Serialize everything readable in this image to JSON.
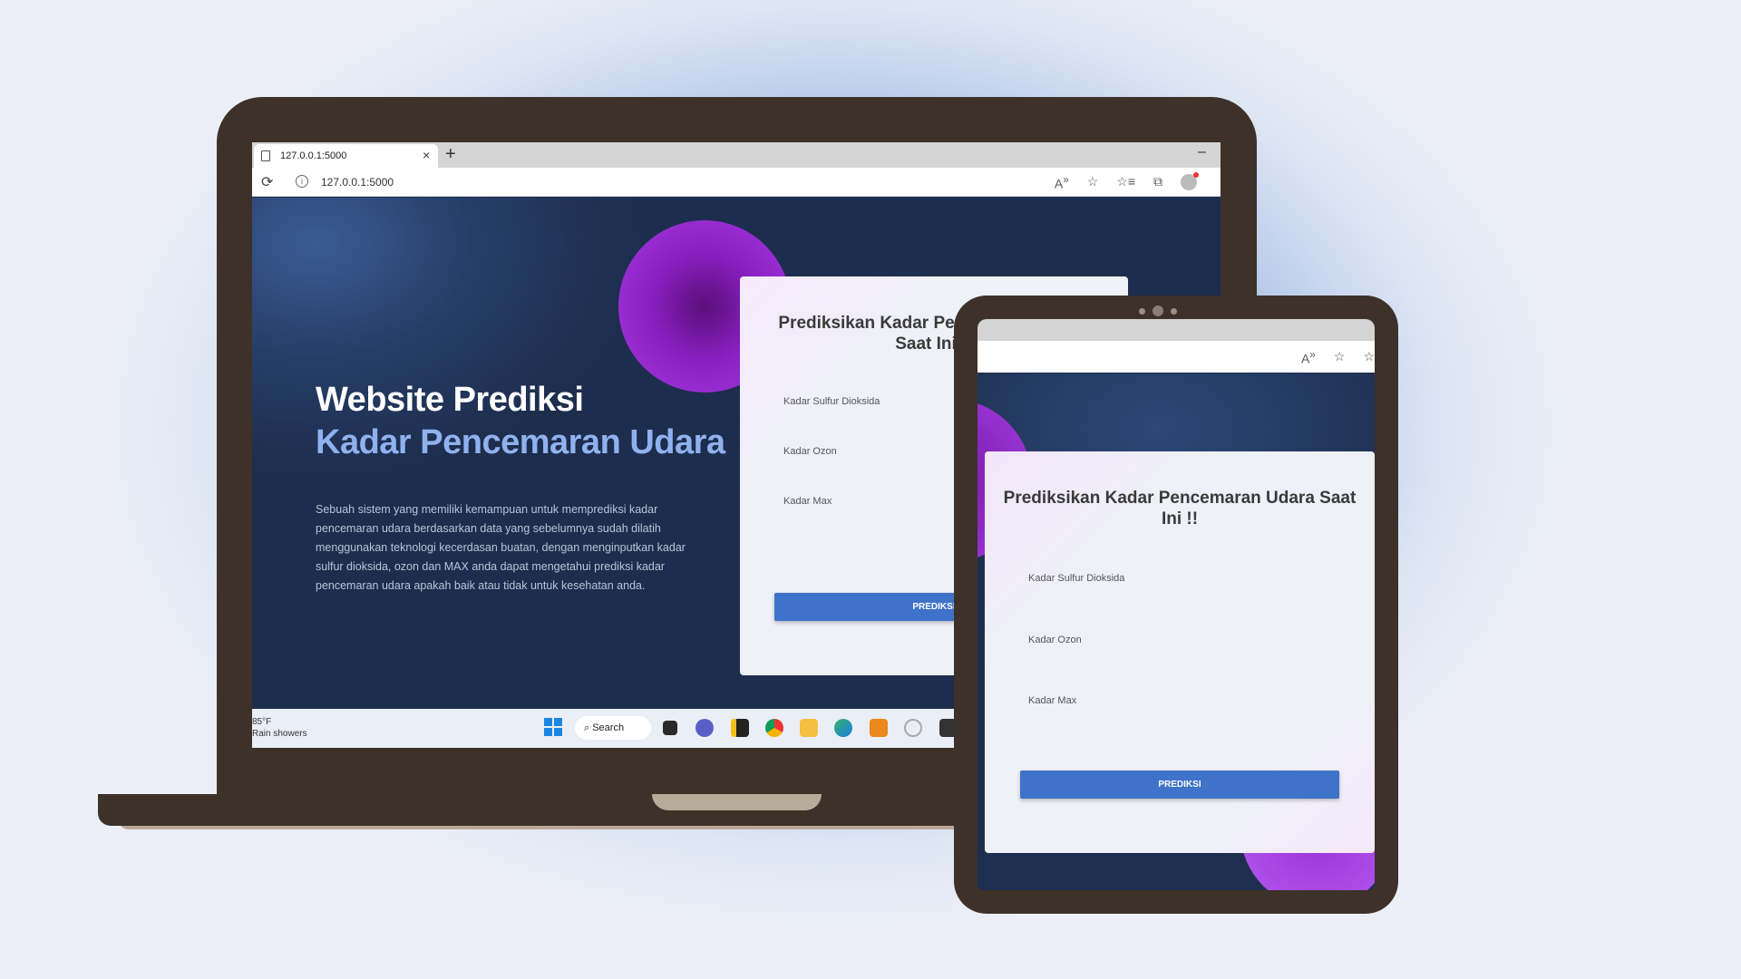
{
  "browser": {
    "tab_title": "127.0.0.1:5000",
    "tab_close": "×",
    "new_tab": "+",
    "minimize": "–",
    "url": "127.0.0.1:5000",
    "reload_icon": "⟳"
  },
  "hero": {
    "title_line1": "Website Prediksi",
    "title_line2": "Kadar Pencemaran Udara",
    "description": "Sebuah sistem yang memiliki kemampuan untuk memprediksi kadar pencemaran udara berdasarkan data yang sebelumnya sudah dilatih menggunakan teknologi kecerdasan buatan, dengan menginputkan kadar sulfur dioksida, ozon dan MAX anda dapat mengetahui prediksi kadar pencemaran udara apakah baik atau tidak untuk kesehatan anda."
  },
  "form": {
    "title": "Prediksikan Kadar Pencemaran Udara Saat Ini !!",
    "fields": [
      {
        "label": "Kadar Sulfur Dioksida"
      },
      {
        "label": "Kadar Ozon"
      },
      {
        "label": "Kadar Max"
      }
    ],
    "submit_label": "PREDIKSI"
  },
  "taskbar": {
    "temperature": "85°F",
    "weather": "Rain showers",
    "search_label": "Search"
  },
  "colors": {
    "accent": "#8fb2ef",
    "button": "#3f73c9",
    "device_frame": "#3d3129",
    "orb": "#8a1fc2"
  }
}
